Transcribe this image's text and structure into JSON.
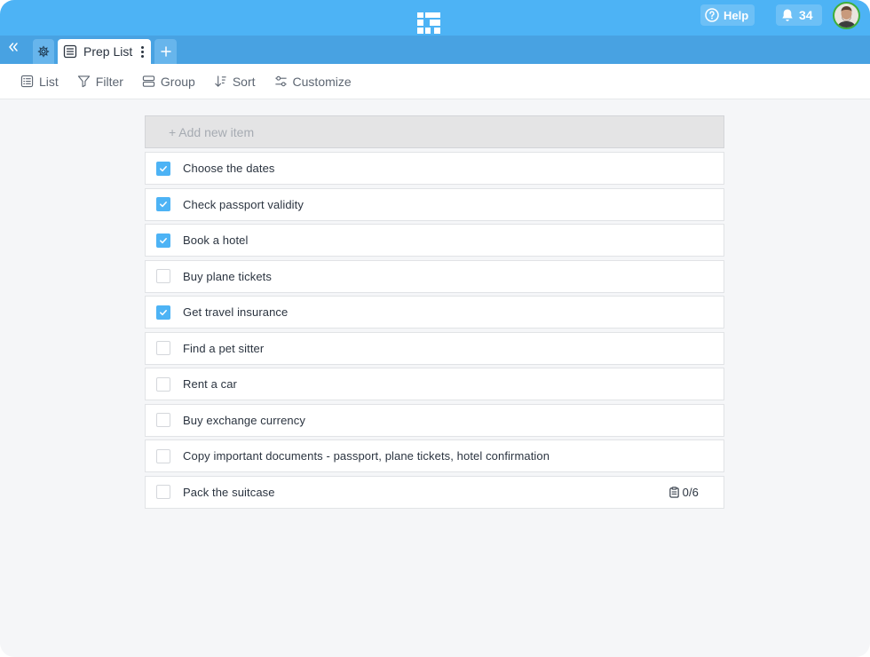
{
  "topbar": {
    "help_label": "Help",
    "notification_count": "34",
    "brand_color": "#4db3f5"
  },
  "tabs": {
    "active_tab_label": "Prep List"
  },
  "toolbar": {
    "list_label": "List",
    "filter_label": "Filter",
    "group_label": "Group",
    "sort_label": "Sort",
    "customize_label": "Customize"
  },
  "list": {
    "add_placeholder": "+ Add new item",
    "items": [
      {
        "text": "Choose the dates",
        "checked": true
      },
      {
        "text": "Check passport validity",
        "checked": true
      },
      {
        "text": "Book a hotel",
        "checked": true
      },
      {
        "text": "Buy plane tickets",
        "checked": false
      },
      {
        "text": "Get travel insurance",
        "checked": true
      },
      {
        "text": "Find a pet sitter",
        "checked": false
      },
      {
        "text": "Rent a car",
        "checked": false
      },
      {
        "text": "Buy exchange currency",
        "checked": false
      },
      {
        "text": "Copy important documents - passport, plane tickets, hotel confirmation",
        "checked": false
      },
      {
        "text": "Pack the suitcase",
        "checked": false,
        "subtasks": "0/6"
      }
    ]
  }
}
